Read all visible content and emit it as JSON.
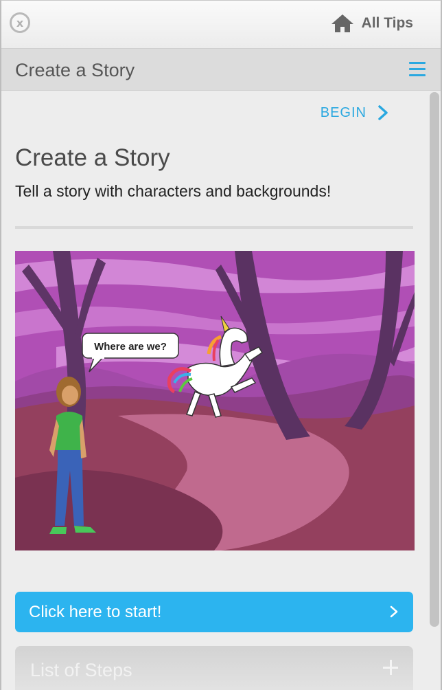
{
  "topbar": {
    "close_glyph": "x",
    "close_icon": "close-icon",
    "all_tips_label": "All Tips",
    "all_tips_icon": "home-icon"
  },
  "header": {
    "title": "Create a Story",
    "menu_icon": "hamburger-menu-icon"
  },
  "main": {
    "begin_label": "BEGIN",
    "begin_icon": "chevron-right-icon",
    "title": "Create a Story",
    "subtitle": "Tell a story with characters and backgrounds!",
    "scene": {
      "speech_bubble_text": "Where are we?"
    },
    "start_button_label": "Click here to start!",
    "start_button_icon": "chevron-right-icon",
    "steps_button_label": "List of Steps",
    "steps_button_icon": "plus-icon"
  },
  "colors": {
    "accent": "#2aa8e0",
    "start_button": "#2cb4ef",
    "scene_sky": "#b353b8",
    "scene_ground": "#94405e"
  }
}
